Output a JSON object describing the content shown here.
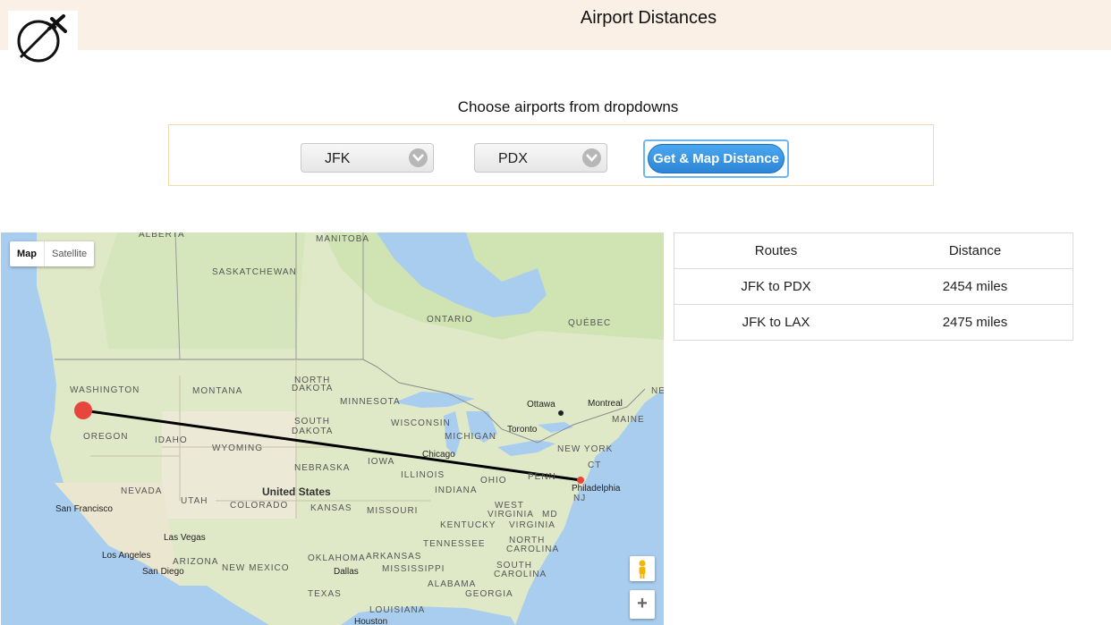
{
  "header": {
    "title": "Airport Distances",
    "logo_icon": "plane-compass-icon"
  },
  "form": {
    "prompt": "Choose airports from dropdowns",
    "origin": {
      "selected": "JFK"
    },
    "destination": {
      "selected": "PDX"
    },
    "submit_label": "Get & Map Distance"
  },
  "map": {
    "type_controls": {
      "map": "Map",
      "satellite": "Satellite"
    },
    "zoom_in": "+",
    "route_line_color": "#000000",
    "marker_color": "#e8453c",
    "labels": {
      "alberta": "ALBERTA",
      "manitoba": "MANITOBA",
      "saskatchewan": "SASKATCHEWAN",
      "ontario": "ONTARIO",
      "quebec": "QUÉBEC",
      "washington": "WASHINGTON",
      "montana": "MONTANA",
      "north_dakota_1": "NORTH",
      "north_dakota_2": "DAKOTA",
      "minnesota": "MINNESOTA",
      "south_dakota_1": "SOUTH",
      "south_dakota_2": "DAKOTA",
      "wisconsin": "WISCONSIN",
      "michigan": "MICHIGAN",
      "oregon": "OREGON",
      "idaho": "IDAHO",
      "wyoming": "WYOMING",
      "nebraska": "NEBRASKA",
      "iowa": "IOWA",
      "illinois": "ILLINOIS",
      "indiana": "INDIANA",
      "ohio": "OHIO",
      "penn": "PENN",
      "new_york": "NEW YORK",
      "maine": "MAINE",
      "nevada": "NEVADA",
      "utah": "UTAH",
      "colorado": "COLORADO",
      "kansas": "KANSAS",
      "missouri": "MISSOURI",
      "kentucky": "KENTUCKY",
      "west_virginia_1": "WEST",
      "west_virginia_2": "VIRGINIA",
      "virginia": "VIRGINIA",
      "north_carolina_1": "NORTH",
      "north_carolina_2": "CAROLINA",
      "tennessee": "TENNESSEE",
      "arizona": "ARIZONA",
      "new_mexico": "NEW MEXICO",
      "oklahoma": "OKLAHOMA",
      "arkansas": "ARKANSAS",
      "south_carolina_1": "SOUTH",
      "south_carolina_2": "CAROLINA",
      "mississippi": "MISSISSIPPI",
      "alabama": "ALABAMA",
      "georgia": "GEORGIA",
      "texas": "TEXAS",
      "louisiana": "LOUISIANA",
      "md": "MD",
      "nj": "NJ",
      "ne": "NE",
      "ct": "CT"
    },
    "cities": {
      "ottawa": "Ottawa",
      "montreal": "Montreal",
      "toronto": "Toronto",
      "chicago": "Chicago",
      "philadelphia": "Philadelphia",
      "san_francisco": "San Francisco",
      "las_vegas": "Las Vegas",
      "los_angeles": "Los Angeles",
      "san_diego": "San Diego",
      "dallas": "Dallas",
      "houston": "Houston"
    },
    "country": "United States"
  },
  "routes_table": {
    "headers": [
      "Routes",
      "Distance"
    ],
    "rows": [
      [
        "JFK to PDX",
        "2454 miles"
      ],
      [
        "JFK to LAX",
        "2475 miles"
      ]
    ]
  }
}
